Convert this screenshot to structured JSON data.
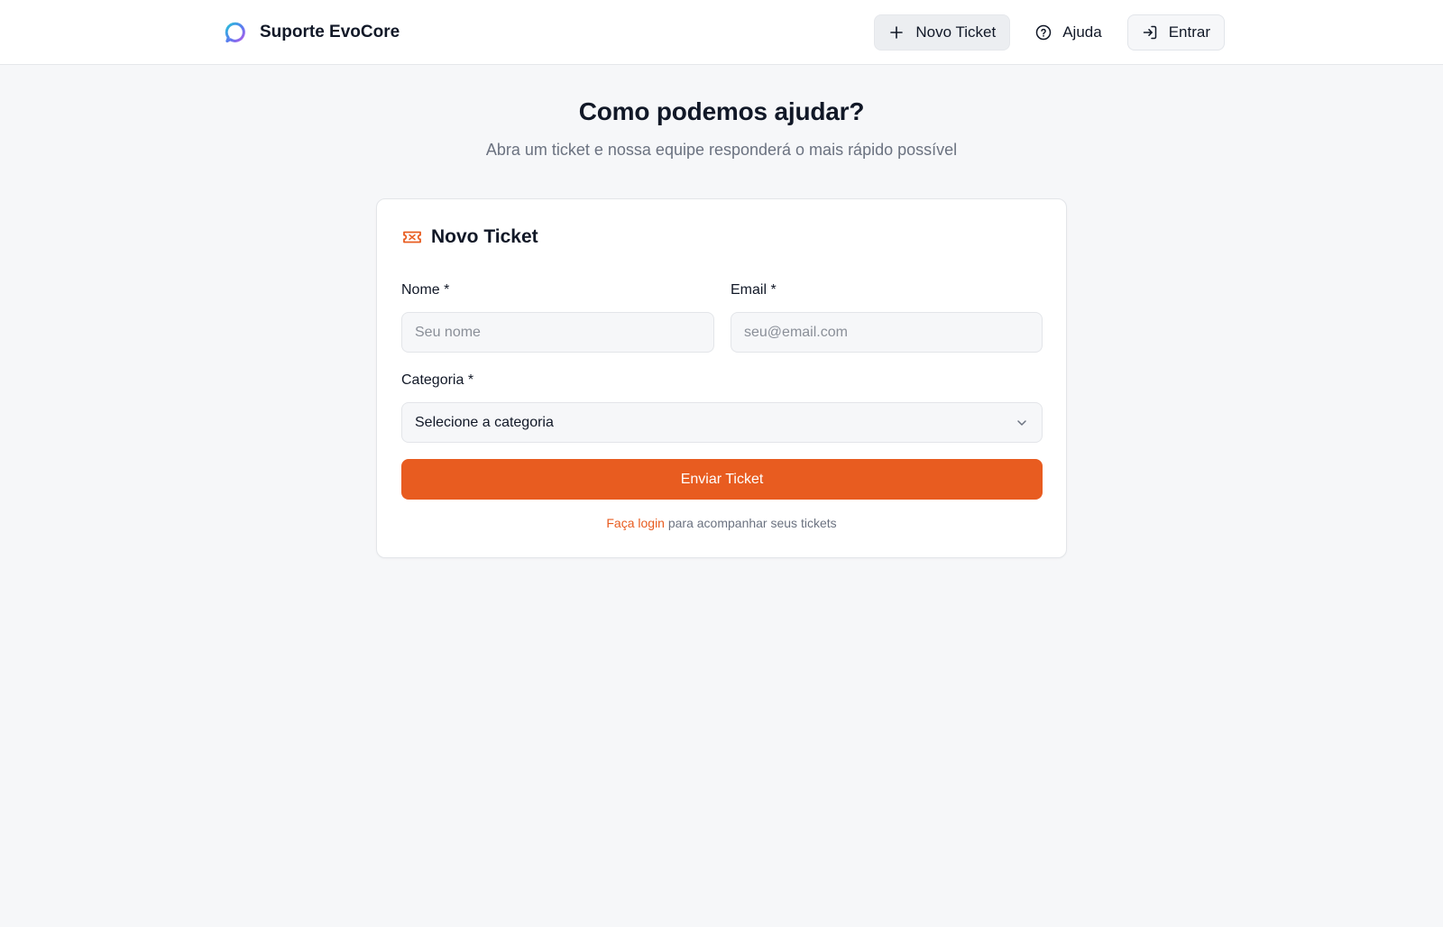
{
  "header": {
    "brand_name": "Suporte EvoCore",
    "nav": {
      "new_ticket_label": "Novo Ticket",
      "help_label": "Ajuda",
      "login_label": "Entrar"
    }
  },
  "hero": {
    "title": "Como podemos ajudar?",
    "subtitle": "Abra um ticket e nossa equipe responderá o mais rápido possível"
  },
  "form": {
    "title": "Novo Ticket",
    "name": {
      "label": "Nome *",
      "placeholder": "Seu nome",
      "value": ""
    },
    "email": {
      "label": "Email *",
      "placeholder": "seu@email.com",
      "value": ""
    },
    "category": {
      "label": "Categoria *",
      "selected": "Selecione a categoria"
    },
    "submit_label": "Enviar Ticket",
    "footnote": {
      "link_text": "Faça login",
      "rest_text": " para acompanhar seus tickets"
    }
  },
  "colors": {
    "accent": "#e85c20",
    "background": "#f6f7f9",
    "text": "#111827",
    "muted": "#6b7280"
  },
  "icons": {
    "brand": "chat-bubble-gradient-icon",
    "new_ticket": "plus-icon",
    "help": "help-circle-icon",
    "login": "log-in-icon",
    "form_title": "ticket-icon",
    "select": "chevron-down-icon"
  }
}
